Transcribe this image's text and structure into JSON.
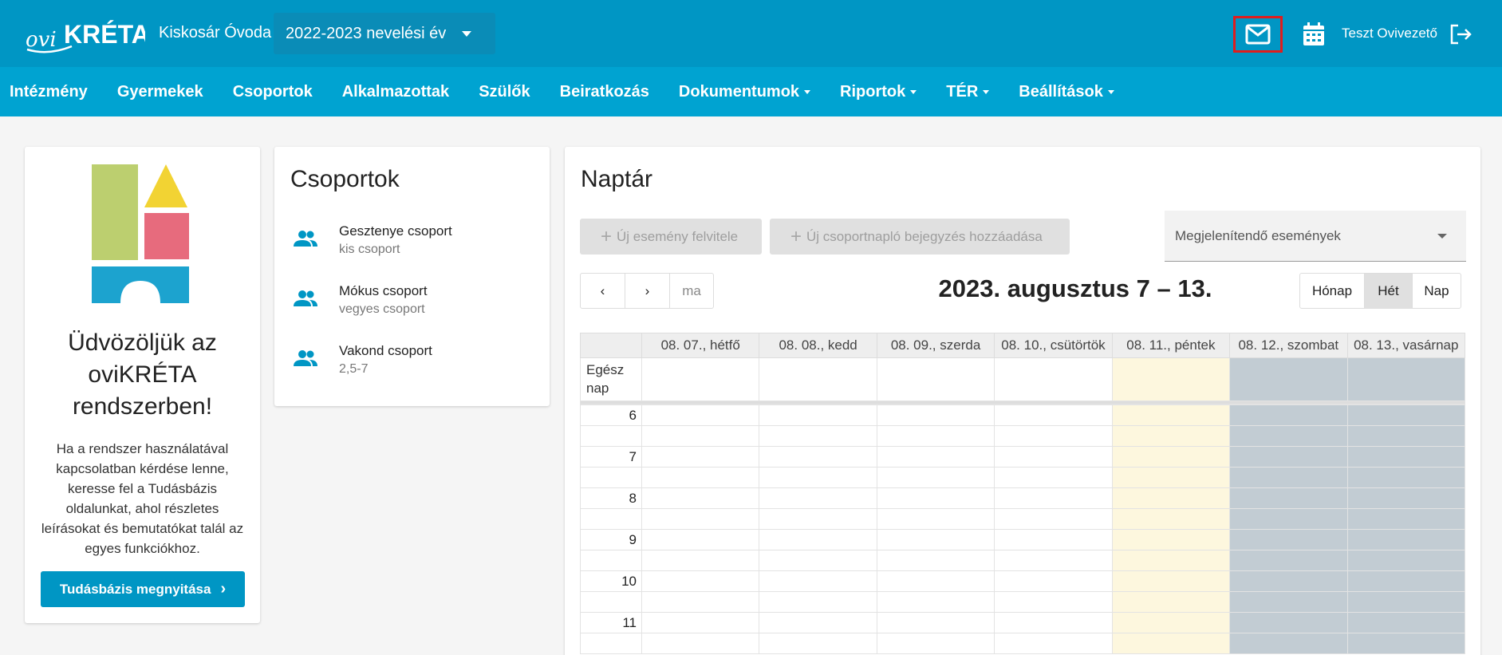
{
  "header": {
    "logo_text": "oviKRÉTA",
    "institution": "Kiskosár Óvoda",
    "school_year": "2022-2023 nevelési év",
    "user": "Teszt Ovivezető",
    "icons": [
      "mail-icon",
      "calendar-icon",
      "logout-icon"
    ],
    "accent_color": "#0096c4"
  },
  "nav": {
    "items": [
      {
        "label": "Intézmény",
        "dropdown": false
      },
      {
        "label": "Gyermekek",
        "dropdown": false
      },
      {
        "label": "Csoportok",
        "dropdown": false
      },
      {
        "label": "Alkalmazottak",
        "dropdown": false
      },
      {
        "label": "Szülők",
        "dropdown": false
      },
      {
        "label": "Beiratkozás",
        "dropdown": false
      },
      {
        "label": "Dokumentumok",
        "dropdown": true
      },
      {
        "label": "Riportok",
        "dropdown": true
      },
      {
        "label": "TÉR",
        "dropdown": true
      },
      {
        "label": "Beállítások",
        "dropdown": true
      }
    ]
  },
  "welcome": {
    "title": "Üdvözöljük az oviKRÉTA rendszerben!",
    "text": "Ha a rendszer használatával kapcsolatban kérdése lenne, keresse fel a Tudásbázis oldalunkat, ahol részletes leírásokat és bemutatókat talál az egyes funkciókhoz.",
    "button": "Tudásbázis megnyitása"
  },
  "groups": {
    "title": "Csoportok",
    "items": [
      {
        "name": "Gesztenye csoport",
        "sub": "kis csoport"
      },
      {
        "name": "Mókus csoport",
        "sub": "vegyes csoport"
      },
      {
        "name": "Vakond csoport",
        "sub": "2,5-7"
      }
    ]
  },
  "calendar": {
    "title": "Naptár",
    "new_event": "Új esemény felvitele",
    "new_log": "Új csoportnapló bejegyzés hozzáadása",
    "event_select_placeholder": "Megjelenítendő események",
    "today_label": "ma",
    "range": "2023. augusztus 7 – 13.",
    "views": [
      "Hónap",
      "Hét",
      "Nap"
    ],
    "active_view": "Hét",
    "allday_label": "Egész nap",
    "days": [
      "08. 07., hétfő",
      "08. 08., kedd",
      "08. 09., szerda",
      "08. 10., csütörtök",
      "08. 11., péntek",
      "08. 12., szombat",
      "08. 13., vasárnap"
    ],
    "hours": [
      "6",
      "7",
      "8",
      "9",
      "10",
      "11"
    ],
    "today_color": "#fdf7de",
    "weekend_color": "#c2ccd3"
  }
}
